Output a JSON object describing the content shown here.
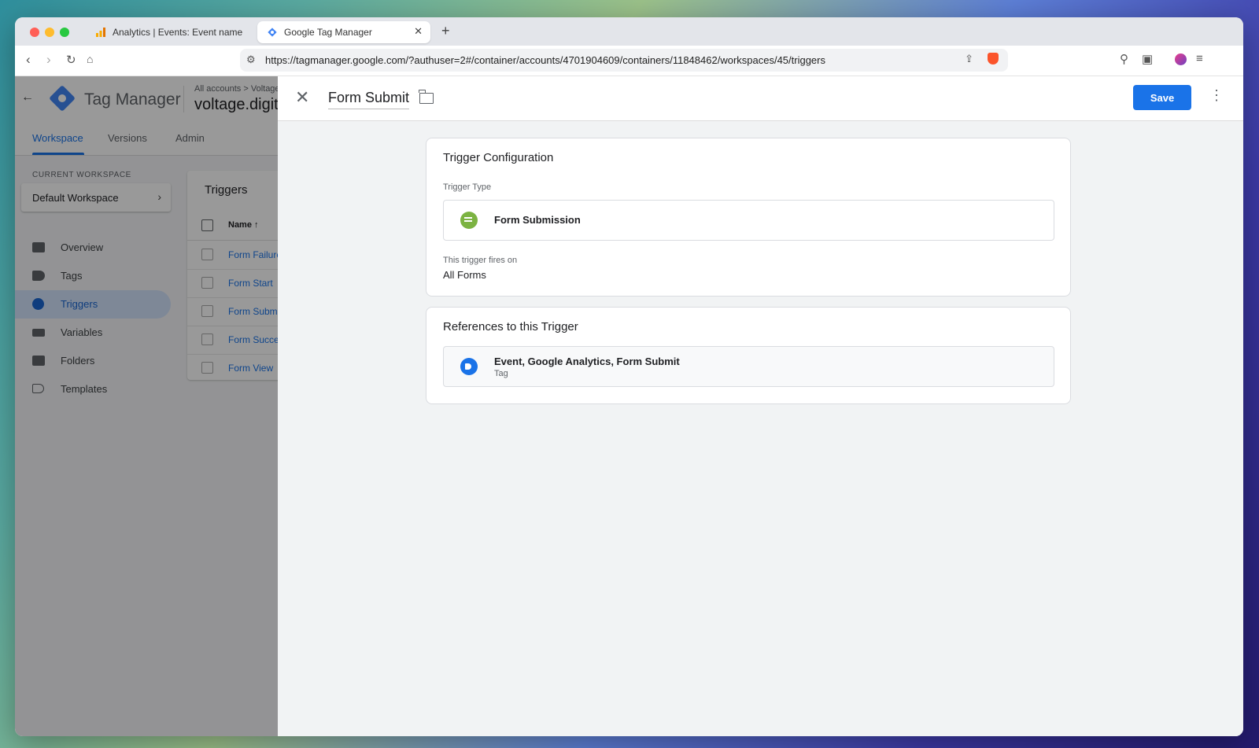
{
  "browser": {
    "tabs": [
      {
        "title": "Analytics | Events: Event name",
        "active": false
      },
      {
        "title": "Google Tag Manager",
        "active": true
      }
    ],
    "url": "https://tagmanager.google.com/?authuser=2#/container/accounts/4701904609/containers/11848462/workspaces/45/triggers"
  },
  "app": {
    "title": "Tag Manager",
    "breadcrumb": "All accounts > Voltage",
    "container_name": "voltage.digital",
    "main_tabs": [
      "Workspace",
      "Versions",
      "Admin"
    ],
    "current_workspace_label": "CURRENT WORKSPACE",
    "workspace_name": "Default Workspace",
    "sidebar": {
      "items": [
        {
          "label": "Overview",
          "icon": "overview-icon"
        },
        {
          "label": "Tags",
          "icon": "tag-icon"
        },
        {
          "label": "Triggers",
          "icon": "trigger-icon",
          "active": true
        },
        {
          "label": "Variables",
          "icon": "variables-icon"
        },
        {
          "label": "Folders",
          "icon": "folder-icon"
        },
        {
          "label": "Templates",
          "icon": "template-icon"
        }
      ]
    },
    "triggers_list": {
      "title": "Triggers",
      "column_name": "Name ↑",
      "rows": [
        "Form Failure",
        "Form Start",
        "Form Submit",
        "Form Success",
        "Form View"
      ]
    }
  },
  "sheet": {
    "title": "Form Submit",
    "save_label": "Save",
    "trigger_config": {
      "title": "Trigger Configuration",
      "type_label": "Trigger Type",
      "type_value": "Form Submission",
      "fires_label": "This trigger fires on",
      "fires_value": "All Forms"
    },
    "references": {
      "title": "References to this Trigger",
      "items": [
        {
          "name": "Event, Google Analytics, Form Submit",
          "type": "Tag"
        }
      ]
    }
  },
  "colors": {
    "accent": "#1a73e8",
    "form_submission_icon": "#7cb342",
    "tag_icon": "#1a73e8"
  }
}
